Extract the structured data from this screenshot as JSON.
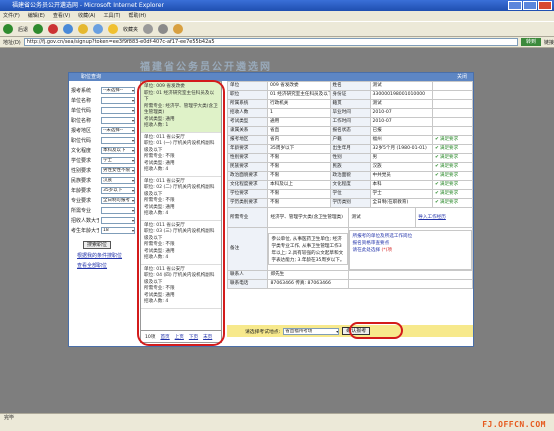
{
  "window": {
    "title": "福建省公务员公开遴选网 - Microsoft Internet Explorer"
  },
  "menu": [
    "文件(F)",
    "编辑(E)",
    "查看(V)",
    "收藏(A)",
    "工具(T)",
    "帮助(H)"
  ],
  "toolbar": {
    "back": "后退",
    "favorites": "收藏夹"
  },
  "address": {
    "label": "地址(D)",
    "url": "http://fj.gov.cn/sea/signup?token=ee3f9f883-e0df-407c-af17-ee7e55b42a5",
    "go": "转到",
    "links": "链接"
  },
  "bg_title": "福建省公务员公开遴选网",
  "modal": {
    "title": "职位查询",
    "close": "关闭"
  },
  "filters": [
    {
      "label": "报考系统",
      "value": "--未选择--"
    },
    {
      "label": "单位名称",
      "value": ""
    },
    {
      "label": "单位代码",
      "value": ""
    },
    {
      "label": "职位名称",
      "value": ""
    },
    {
      "label": "报考地区",
      "value": "--未选择--"
    },
    {
      "label": "职位代码",
      "value": ""
    },
    {
      "label": "文化程度",
      "value": "本科及以下"
    },
    {
      "label": "学位要求",
      "value": "学士"
    },
    {
      "label": "性别要求",
      "value": "男性女性不限"
    },
    {
      "label": "民族要求",
      "value": "汉族"
    },
    {
      "label": "年龄要求",
      "value": "35岁以下"
    },
    {
      "label": "专业要求",
      "value": "全日制可报考"
    },
    {
      "label": "所需专业",
      "value": ""
    },
    {
      "label": "招收人数大于",
      "value": ""
    },
    {
      "label": "考生年龄大于",
      "value": "18"
    }
  ],
  "search_btn": "搜索职位",
  "links": [
    "根据我的条件搜职位",
    "查看全部职位"
  ],
  "jobs": [
    {
      "unit": "单位: 009 省发改委",
      "pos": "职位: 01 经济研究室主任科员及以下",
      "major": "所需专业: 经济学、管理学大类(含卫生管理类)",
      "type": "考试类型: 通用",
      "count": "招收人数: 1"
    },
    {
      "unit": "单位: 011 省公安厅",
      "pos": "职位: 01 (一) 厅机关内设机构副科级及以下",
      "major": "所需专业: 不限",
      "type": "考试类型: 通用",
      "count": "招收人数: 4"
    },
    {
      "unit": "单位: 011 省公安厅",
      "pos": "职位: 02 (二) 厅机关内设机构副科级及以下",
      "major": "所需专业: 不限",
      "type": "考试类型: 通用",
      "count": "招收人数: 4"
    },
    {
      "unit": "单位: 011 省公安厅",
      "pos": "职位: 03 (三) 厅机关内设机构副科级及以下",
      "major": "所需专业: 不限",
      "type": "考试类型: 通用",
      "count": "招收人数: 4"
    },
    {
      "unit": "单位: 011 省公安厅",
      "pos": "职位: 04 (四) 厅机关内设机构副科级及以下",
      "major": "所需专业: 不限",
      "type": "考试类型: 通用",
      "count": "招收人数: 4"
    }
  ],
  "pager": {
    "count": "10项",
    "first": "首页",
    "prev": "上页",
    "next": "下页",
    "last": "末页"
  },
  "detail": [
    [
      "单位",
      "009 省发改委",
      "姓名",
      "测试"
    ],
    [
      "职位",
      "01 经济研究室主任科员及以下",
      "身份证",
      "330000198001010000"
    ],
    [
      "所属系统",
      "行政机关",
      "籍贯",
      "测试"
    ],
    [
      "招收人数",
      "1",
      "毕业时间",
      "2010-07"
    ],
    [
      "考试类型",
      "通用",
      "工作时间",
      "2010-07"
    ],
    [
      "隶属关系",
      "省直",
      "报名状态",
      "已报"
    ],
    [
      "报考地区",
      "省内",
      "户籍",
      "福州"
    ],
    [
      "年龄要求",
      "35周岁以下",
      "出生年月",
      "32岁5个月 (1980-01-01)"
    ],
    [
      "性别要求",
      "不限",
      "性别",
      "男"
    ],
    [
      "民族要求",
      "不限",
      "民族",
      "汉族"
    ],
    [
      "政治面貌要求",
      "不限",
      "政治面貌",
      "中共党员"
    ],
    [
      "文化程度要求",
      "本科及以上",
      "文化程度",
      "本科"
    ],
    [
      "学位要求",
      "不限",
      "学位",
      "学士"
    ],
    [
      "学历类别要求",
      "不限",
      "学历类别",
      "全日制(在职教育)"
    ]
  ],
  "detail_status": "满足要求",
  "major_row": {
    "key": "所需专业",
    "value": "经济学、管理学大类(含卫生管理类)",
    "user": "测试",
    "link": "导入工作经历"
  },
  "cert_box": {
    "line1": "所报考的单位及所选工作岗位",
    "line2": "报名资格审查要点",
    "note": "请在此处选择",
    "flag": "(*)项"
  },
  "remarks": {
    "key": "备注",
    "value": "参公单位, 从事医药卫生单位; 经济学类专业工作, 从事卫生管理工作3年以上; 2.具有较强的公文起草和文字表达能力; 3.年龄在35周岁以下。"
  },
  "contact": [
    [
      "联系人",
      "郑先生"
    ],
    [
      "联系电话",
      "87063466 传真: 87063466"
    ]
  ],
  "bottom": {
    "label": "请选择考试地点:",
    "select": "省直福州考场",
    "confirm": "确认报考"
  },
  "status": "完毕",
  "watermark": "FJ.OFFCN.COM"
}
